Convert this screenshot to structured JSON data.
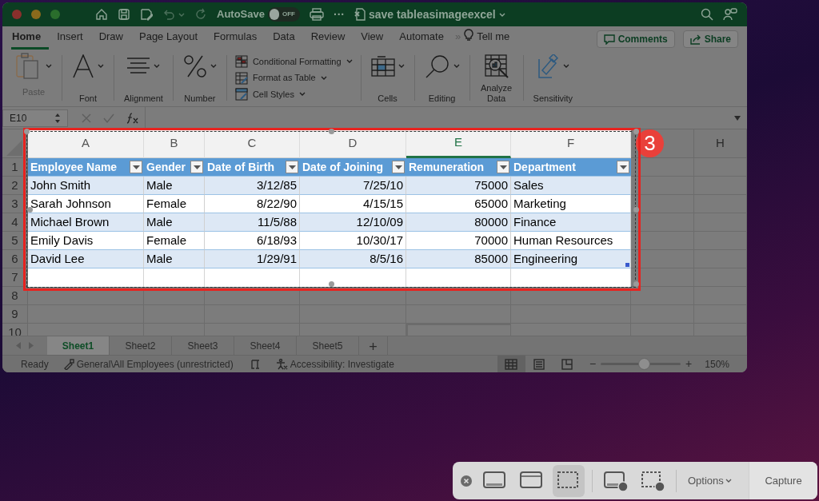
{
  "title_bar": {
    "autosave_label": "AutoSave",
    "autosave": {
      "on": false,
      "label": "OFF"
    },
    "more": "···",
    "document_title": "save tableasimageexcel"
  },
  "ribbon_tabs": [
    {
      "label": "Home",
      "selected": true
    },
    {
      "label": "Insert",
      "selected": false
    },
    {
      "label": "Draw",
      "selected": false
    },
    {
      "label": "Page Layout",
      "selected": false
    },
    {
      "label": "Formulas",
      "selected": false
    },
    {
      "label": "Data",
      "selected": false
    },
    {
      "label": "Review",
      "selected": false
    },
    {
      "label": "View",
      "selected": false
    },
    {
      "label": "Automate",
      "selected": false
    }
  ],
  "overflow": "»",
  "tell_me": "Tell me",
  "comments_button": "Comments",
  "share_button": "Share",
  "ribbon_groups": [
    {
      "kind": "paste",
      "label": "Paste",
      "disabled": true
    },
    {
      "kind": "font",
      "label": "Font",
      "disabled": false
    },
    {
      "kind": "alignment",
      "label": "Alignment",
      "disabled": false
    },
    {
      "kind": "number",
      "label": "Number",
      "disabled": false
    },
    {
      "kind": "styles",
      "items": [
        "Conditional Formatting",
        "Format as Table",
        "Cell Styles"
      ]
    },
    {
      "kind": "cells",
      "label": "Cells",
      "disabled": false
    },
    {
      "kind": "editing",
      "label": "Editing",
      "disabled": false
    },
    {
      "kind": "analyze",
      "label": "Analyze Data",
      "disabled": false
    },
    {
      "kind": "sensitivity",
      "label": "Sensitivity",
      "disabled": false
    }
  ],
  "name_box": "E10",
  "columns": [
    {
      "label": "A",
      "selected": false
    },
    {
      "label": "B",
      "selected": false
    },
    {
      "label": "C",
      "selected": false
    },
    {
      "label": "D",
      "selected": false
    },
    {
      "label": "E",
      "selected": true
    },
    {
      "label": "F",
      "selected": false
    },
    {
      "selected": false
    },
    {
      "label": "H",
      "selected": false
    }
  ],
  "row_numbers": [
    "1",
    "2",
    "3",
    "4",
    "5",
    "6",
    "7",
    "8",
    "9",
    "10"
  ],
  "table": {
    "headers": [
      "Employee Name",
      "Gender",
      "Date of Birth",
      "Date of Joining",
      "Remuneration",
      "Department"
    ],
    "rows": [
      [
        "John Smith",
        "Male",
        "3/12/85",
        "7/25/10",
        "75000",
        "Sales"
      ],
      [
        "Sarah Johnson",
        "Female",
        "8/22/90",
        "4/15/15",
        "65000",
        "Marketing"
      ],
      [
        "Michael Brown",
        "Male",
        "11/5/88",
        "12/10/09",
        "80000",
        "Finance"
      ],
      [
        "Emily Davis",
        "Female",
        "6/18/93",
        "10/30/17",
        "70000",
        "Human Resources"
      ],
      [
        "David Lee",
        "Male",
        "1/29/91",
        "8/5/16",
        "85000",
        "Engineering"
      ]
    ]
  },
  "callout": "3",
  "sheet_tabs": [
    {
      "label": "Sheet1",
      "selected": true
    },
    {
      "label": "Sheet2",
      "selected": false
    },
    {
      "label": "Sheet3",
      "selected": false
    },
    {
      "label": "Sheet4",
      "selected": false
    },
    {
      "label": "Sheet5",
      "selected": false
    }
  ],
  "add_sheet": "+",
  "status_bar": {
    "ready": "Ready",
    "sensitivity": "General\\All Employees (unrestricted)",
    "accessibility": "Accessibility: Investigate",
    "views": [
      {
        "kind": "normal",
        "selected": true
      },
      {
        "kind": "page-layout",
        "selected": false
      },
      {
        "kind": "page-break",
        "selected": false
      }
    ],
    "zoom_out": "−",
    "zoom_in": "+",
    "zoom": {
      "level": 0.55
    },
    "zoom_label": "150%"
  },
  "capture_toolbar": {
    "modes": [
      {
        "kind": "screen",
        "selected": false
      },
      {
        "kind": "window",
        "selected": false
      },
      {
        "kind": "selection",
        "selected": true
      },
      {
        "kind": "record-screen",
        "selected": false
      },
      {
        "kind": "record-selection",
        "selected": false
      }
    ],
    "options": "Options",
    "capture": "Capture"
  }
}
